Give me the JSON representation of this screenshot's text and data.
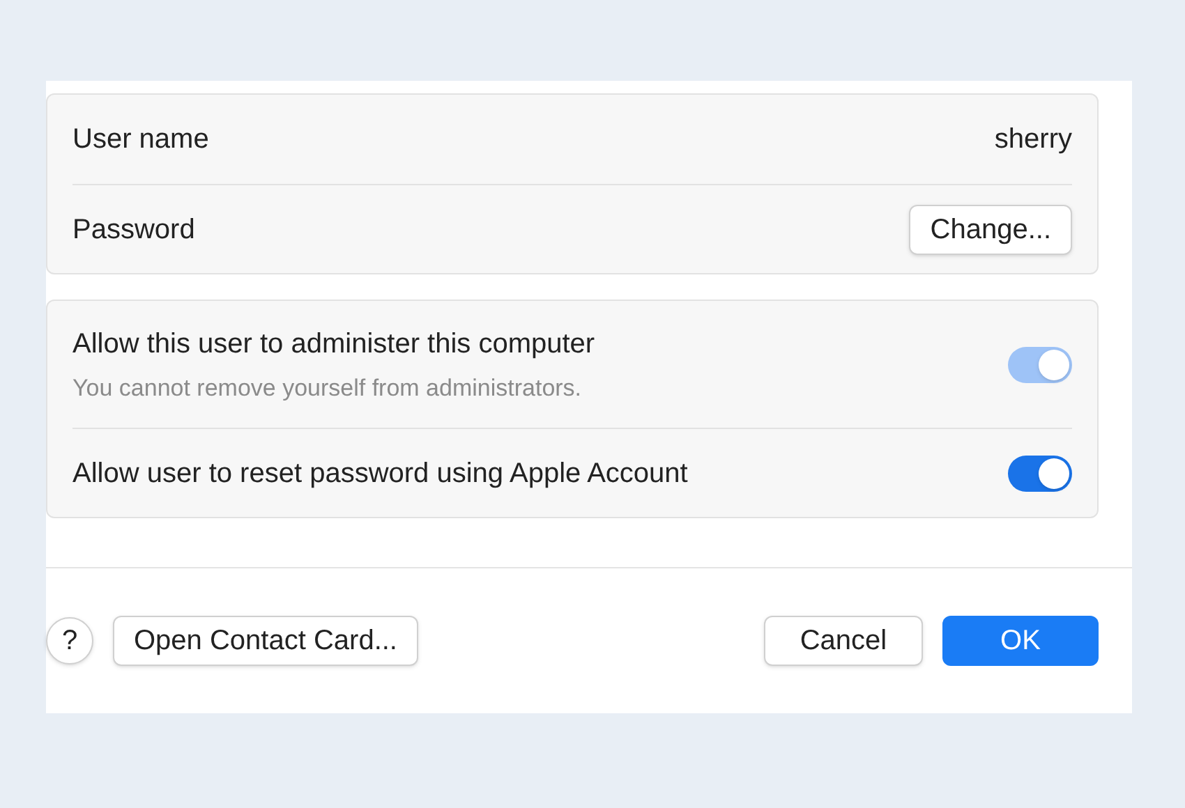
{
  "account": {
    "rows": [
      {
        "label": "User name",
        "kind": "value",
        "value": "sherry"
      },
      {
        "label": "Password",
        "kind": "button",
        "button": "Change..."
      }
    ]
  },
  "options": [
    {
      "label": "Allow this user to administer this computer",
      "note": "You cannot remove yourself from administrators.",
      "on": true,
      "disabled": true
    },
    {
      "label": "Allow user to reset password using Apple Account",
      "on": true,
      "disabled": false
    }
  ],
  "footer": {
    "help": "?",
    "contact_button": "Open Contact Card...",
    "cancel_button": "Cancel",
    "ok_button": "OK"
  }
}
